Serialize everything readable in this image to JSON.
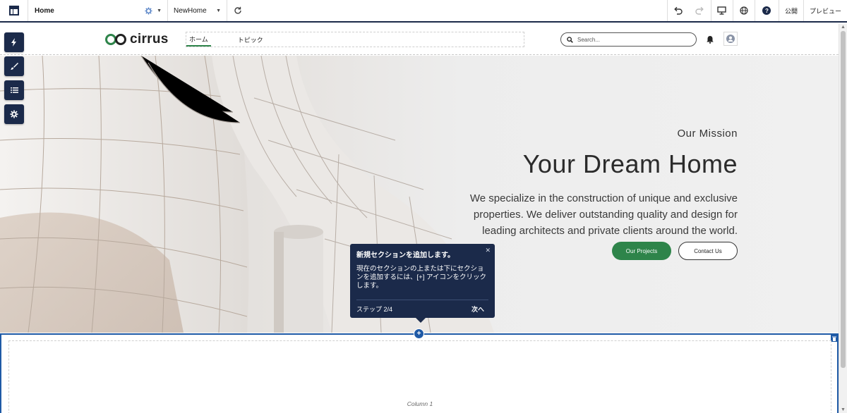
{
  "builder": {
    "page_name": "Home",
    "variant_name": "NewHome",
    "publish_label": "公開",
    "preview_label": "プレビュー"
  },
  "site": {
    "brand": "cirrus",
    "nav": [
      {
        "label": "ホーム",
        "active": true
      },
      {
        "label": "トピック",
        "active": false
      }
    ],
    "search_placeholder": "Search..."
  },
  "hero": {
    "kicker": "Our Mission",
    "headline": "Your Dream Home",
    "description": "We specialize in the construction of unique and exclusive properties. We deliver outstanding quality and design for leading architects and private clients around the world.",
    "primary_cta": "Our Projects",
    "secondary_cta": "Contact Us"
  },
  "coach_mark": {
    "title": "新規セクションを追加します。",
    "body": "現在のセクションの上または下にセクションを追加するには、[+] アイコンをクリックします。",
    "step": "ステップ 2/4",
    "next_label": "次へ"
  },
  "section": {
    "column_label": "Column 1"
  },
  "colors": {
    "builder_navy": "#1b2a4a",
    "brand_green": "#2e844a",
    "selection_blue": "#1f5aa6"
  }
}
